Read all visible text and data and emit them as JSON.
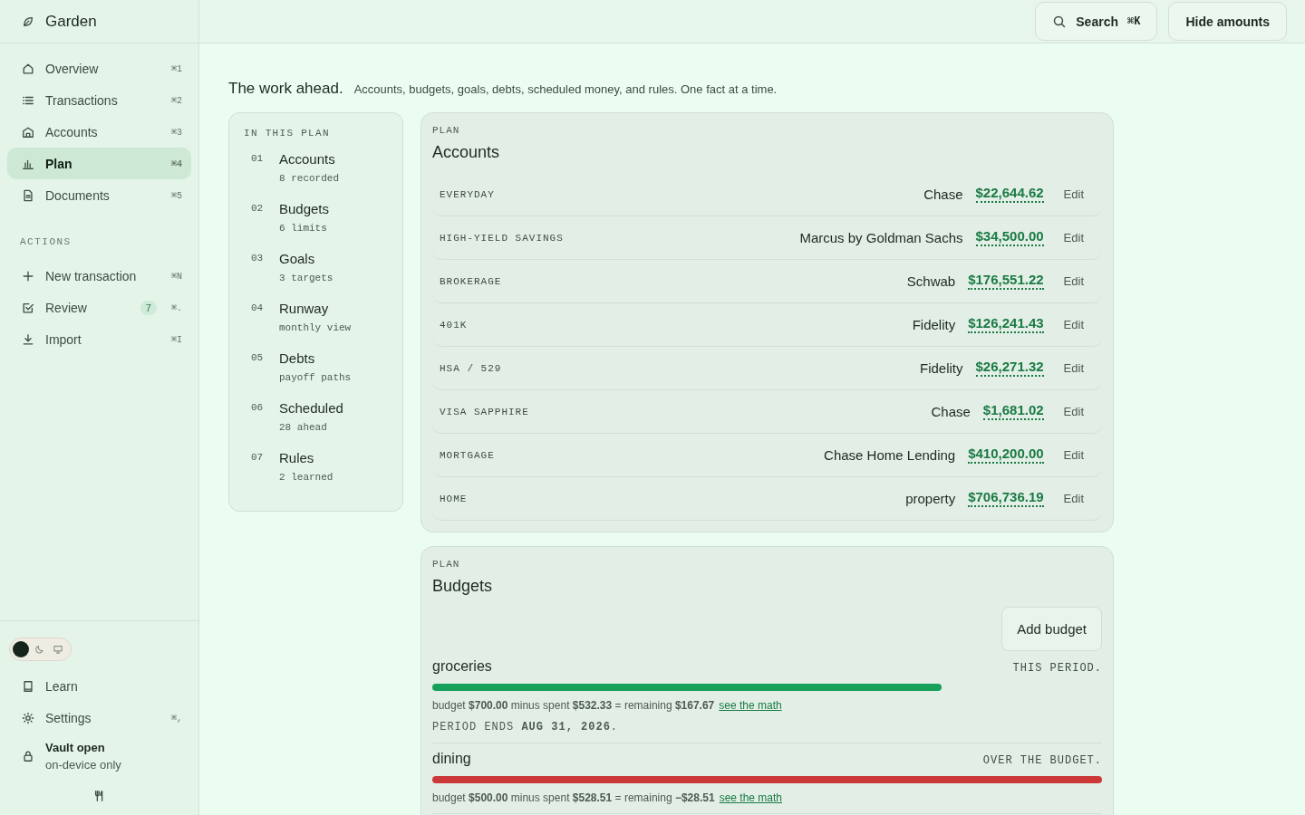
{
  "sidebar": {
    "brand": "Garden",
    "nav": [
      {
        "label": "Overview",
        "shortcut": "⌘1",
        "selected": false
      },
      {
        "label": "Transactions",
        "shortcut": "⌘2",
        "selected": false
      },
      {
        "label": "Accounts",
        "shortcut": "⌘3",
        "selected": false
      },
      {
        "label": "Plan",
        "shortcut": "⌘4",
        "selected": true
      },
      {
        "label": "Documents",
        "shortcut": "⌘5",
        "selected": false
      }
    ],
    "actions_heading": "ACTIONS",
    "actions": [
      {
        "label": "New transaction",
        "shortcut": "⌘N"
      },
      {
        "label": "Review",
        "badge": "7",
        "shortcut": "⌘."
      },
      {
        "label": "Import",
        "shortcut": "⌘I"
      }
    ],
    "theme": [
      {
        "kind": "light",
        "selected": true
      },
      {
        "kind": "dark",
        "selected": false
      },
      {
        "kind": "system",
        "selected": false
      }
    ],
    "footer": [
      {
        "label": "Learn"
      },
      {
        "label": "Settings",
        "shortcut": "⌘,"
      }
    ],
    "vault": {
      "title": "Vault open",
      "subtitle": "on-device only"
    }
  },
  "topbar": {
    "search": {
      "label": "Search",
      "shortcut": "⌘K"
    },
    "hide_button": "Hide amounts"
  },
  "header": {
    "title": "The work ahead.",
    "subtitle": "Accounts, budgets, goals, debts, scheduled money, and rules. One fact at a time."
  },
  "toc": {
    "heading": "IN THIS PLAN",
    "items": [
      {
        "number": "01",
        "title": "Accounts",
        "note": "8 recorded"
      },
      {
        "number": "02",
        "title": "Budgets",
        "note": "6 limits"
      },
      {
        "number": "03",
        "title": "Goals",
        "note": "3 targets"
      },
      {
        "number": "04",
        "title": "Runway",
        "note": "monthly view"
      },
      {
        "number": "05",
        "title": "Debts",
        "note": "payoff paths"
      },
      {
        "number": "06",
        "title": "Scheduled",
        "note": "28 ahead"
      },
      {
        "number": "07",
        "title": "Rules",
        "note": "2 learned"
      }
    ]
  },
  "accounts": {
    "eyebrow": "PLAN",
    "title": "Accounts",
    "rows": [
      {
        "type": "EVERYDAY",
        "institution": "Chase",
        "balance": "$22,644.62",
        "action": "Edit"
      },
      {
        "type": "HIGH-YIELD SAVINGS",
        "institution": "Marcus by Goldman Sachs",
        "balance": "$34,500.00",
        "action": "Edit"
      },
      {
        "type": "BROKERAGE",
        "institution": "Schwab",
        "balance": "$176,551.22",
        "action": "Edit"
      },
      {
        "type": "401K",
        "institution": "Fidelity",
        "balance": "$126,241.43",
        "action": "Edit"
      },
      {
        "type": "HSA / 529",
        "institution": "Fidelity",
        "balance": "$26,271.32",
        "action": "Edit"
      },
      {
        "type": "VISA SAPPHIRE",
        "institution": "Chase",
        "balance": "$1,681.02",
        "action": "Edit"
      },
      {
        "type": "MORTGAGE",
        "institution": "Chase Home Lending",
        "balance": "$410,200.00",
        "action": "Edit"
      },
      {
        "type": "HOME",
        "institution": "property",
        "balance": "$706,736.19",
        "action": "Edit"
      }
    ]
  },
  "budgets": {
    "eyebrow": "PLAN",
    "title": "Budgets",
    "add_button": "Add budget",
    "items": [
      {
        "name": "groceries",
        "status": "THIS PERIOD.",
        "over": false,
        "level": 0.76,
        "math": "budget **$700.00** minus spent **$532.33** = remaining **$167.67**",
        "link": "see the math",
        "period": "PERIOD ENDS **AUG 31, 2026**."
      },
      {
        "name": "dining",
        "status": "OVER THE BUDGET.",
        "over": true,
        "level": 1,
        "math": "budget **$500.00** minus spent **$528.51** = remaining **−$28.51**",
        "link": "see the math"
      }
    ]
  }
}
